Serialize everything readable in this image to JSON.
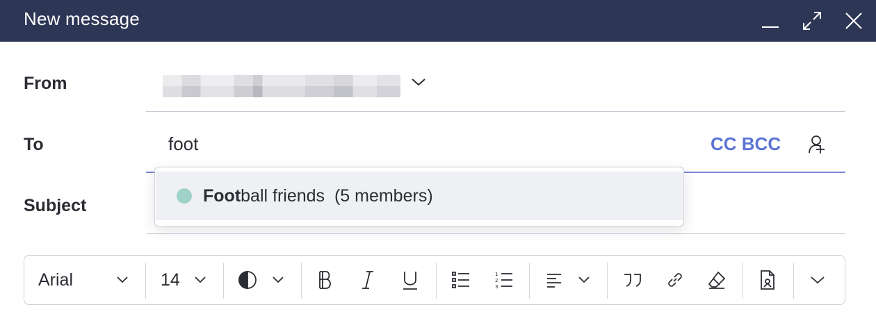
{
  "window": {
    "title": "New message",
    "controls": [
      "minimize-icon",
      "expand-icon",
      "close-icon"
    ]
  },
  "fields": {
    "from_label": "From",
    "to_label": "To",
    "subject_label": "Subject",
    "to_value": "foot",
    "cc_bcc_label": "CC BCC"
  },
  "suggestion": {
    "match": "Foot",
    "rest": "ball friends",
    "members": "(5 members)",
    "dot_color": "#9fd2c6"
  },
  "toolbar": {
    "font_family": "Arial",
    "font_size": "14",
    "icons": [
      "contrast-icon",
      "bold-icon",
      "italic-icon",
      "underline-icon",
      "bullet-list-icon",
      "numbered-list-icon",
      "align-left-icon",
      "quote-icon",
      "link-icon",
      "eraser-icon",
      "template-icon",
      "more-chevron-icon"
    ]
  },
  "colors": {
    "titlebar": "#2e3656",
    "accent": "#5b74d6"
  }
}
